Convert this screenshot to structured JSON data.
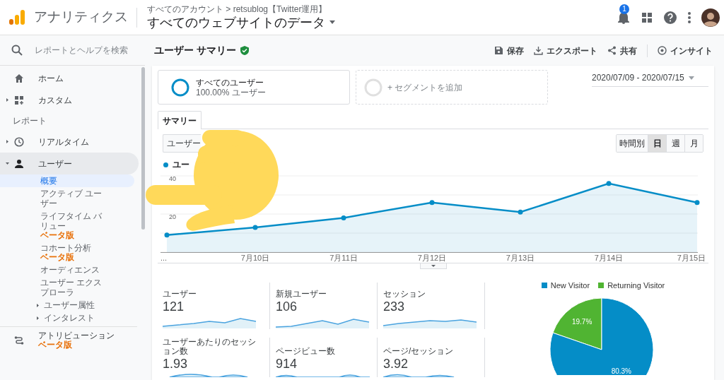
{
  "header": {
    "product": "アナリティクス",
    "breadcrumb": "すべてのアカウント > retsublog【Twitter運用】",
    "view": "すべてのウェブサイトのデータ",
    "notification_count": "1"
  },
  "sidebar": {
    "search_placeholder": "レポートとヘルプを検索",
    "items": [
      {
        "kind": "item",
        "label": "ホーム",
        "selected": false
      },
      {
        "kind": "item",
        "label": "カスタム",
        "expanded": false,
        "selected": false
      },
      {
        "kind": "heading",
        "label": "レポート"
      },
      {
        "kind": "item",
        "label": "リアルタイム",
        "expanded": false,
        "selected": false
      },
      {
        "kind": "item",
        "label": "ユーザー",
        "expanded": true,
        "selected": false,
        "children": [
          {
            "label": "概要",
            "selected": true
          },
          {
            "label": "アクティブ ユーザー",
            "selected": false
          },
          {
            "label": "ライフタイム バリュー",
            "badge": "ベータ版",
            "selected": false
          },
          {
            "label": "コホート分析",
            "badge": "ベータ版",
            "selected": false
          },
          {
            "label": "オーディエンス",
            "selected": false
          },
          {
            "label": "ユーザー エクスプローラ",
            "selected": false
          },
          {
            "label": "ユーザー属性",
            "expanded": false,
            "selected": false
          },
          {
            "label": "インタレスト",
            "expanded": false,
            "selected": false
          }
        ]
      },
      {
        "kind": "item",
        "label": "アトリビューション",
        "badge": "ベータ版",
        "selected": false
      }
    ]
  },
  "report": {
    "title": "ユーザー サマリー",
    "actions": [
      {
        "label": "保存"
      },
      {
        "label": "エクスポート"
      },
      {
        "label": "共有"
      },
      {
        "label": "インサイト"
      }
    ]
  },
  "segments": [
    {
      "kind": "segment",
      "title": "すべてのユーザー",
      "subtitle": "100.00% ユーザー"
    },
    {
      "kind": "add",
      "title": "+ セグメントを追加"
    }
  ],
  "date_range": "2020/07/09 - 2020/07/15",
  "tabs": [
    {
      "label": "サマリー",
      "selected": true
    }
  ],
  "metric_selector": "ユーザー",
  "granularity": [
    {
      "label": "時間別",
      "selected": false
    },
    {
      "label": "日",
      "selected": true
    },
    {
      "label": "週",
      "selected": false
    },
    {
      "label": "月",
      "selected": false
    }
  ],
  "line_chart": {
    "chart_data": {
      "type": "area",
      "categories": [
        "...",
        "7月10日",
        "7月11日",
        "7月12日",
        "7月13日",
        "7月14日",
        "7月15日"
      ],
      "series": [
        {
          "name": "ユー",
          "color": "#058dc7",
          "values": [
            9,
            13,
            18,
            26,
            21,
            36,
            26
          ]
        }
      ],
      "ylim": [
        0,
        40
      ],
      "yticks": [
        20,
        40
      ]
    }
  },
  "metrics": [
    {
      "label": "ユーザー",
      "value": "121"
    },
    {
      "label": "新規ユーザー",
      "value": "106"
    },
    {
      "label": "セッション",
      "value": "233"
    },
    {
      "label": "ユーザーあたりのセッション数",
      "value": "1.93"
    },
    {
      "label": "ページビュー数",
      "value": "914"
    },
    {
      "label": "ページ/セッション",
      "value": "3.92"
    }
  ],
  "pie_chart": {
    "chart_data": {
      "type": "pie",
      "categories": [
        "New Visitor",
        "Returning Visitor"
      ],
      "values": [
        80.3,
        19.7
      ],
      "value_labels": [
        "80.3%",
        "19.7%"
      ]
    }
  },
  "overlay": {
    "kind": "pointing-hand"
  }
}
